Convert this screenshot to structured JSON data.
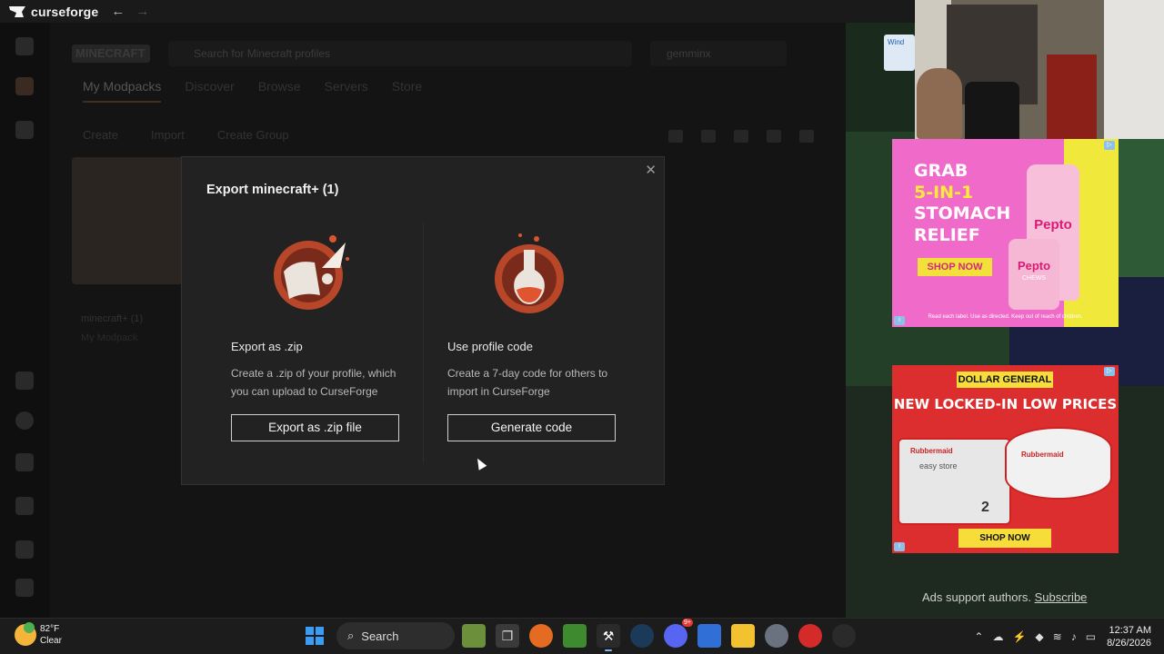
{
  "window": {
    "app_name": "curseforge",
    "back_icon": "arrow-left-icon",
    "forward_icon": "arrow-right-icon"
  },
  "background_app": {
    "tabs": [
      "My Modpacks",
      "Discover",
      "Browse",
      "Servers",
      "Store"
    ],
    "toolbar": [
      "Create",
      "Import",
      "Create Group"
    ],
    "search_placeholder": "Search for Minecraft profiles",
    "account": "gemminx",
    "mod_card_title": "minecraft+ (1)",
    "mod_card_sub": "My Modpack"
  },
  "modal": {
    "title": "Export minecraft+ (1)",
    "close_icon": "close-icon",
    "options": [
      {
        "icon": "scroll-quill-icon",
        "title": "Export as .zip",
        "description": "Create a .zip of your profile, which you can upload to CurseForge",
        "button": "Export as .zip file"
      },
      {
        "icon": "potion-flask-icon",
        "title": "Use profile code",
        "description": "Create a 7-day code for others to import in CurseForge",
        "button": "Generate code"
      }
    ]
  },
  "ads": {
    "ad1": {
      "headline_1": "GRAB",
      "headline_2": "5-IN-1",
      "headline_3": "STOMACH",
      "headline_4": "RELIEF",
      "cta": "SHOP NOW",
      "bottle_label": "Pepto",
      "jar_label": "Pepto",
      "jar_sub": "CHEWS",
      "fine_print": "Read each label. Use as directed. Keep out of reach of children."
    },
    "ad2": {
      "brand": "DOLLAR GENERAL",
      "headline": "NEW LOCKED-IN LOW PRICES",
      "product_brand": "Rubbermaid",
      "product_name": "easy store",
      "count": "2",
      "cta": "SHOP NOW"
    },
    "footer_text": "Ads support authors.",
    "footer_link": "Subscribe"
  },
  "taskbar": {
    "weather_temp": "82°F",
    "weather_cond": "Clear",
    "search_label": "Search",
    "discord_badge": "9+",
    "time": "12:37 AM",
    "date": "8/26/2026"
  },
  "colors": {
    "accent": "#e0552f",
    "modal_bg": "#222222",
    "button_border": "#cfcfcf"
  }
}
